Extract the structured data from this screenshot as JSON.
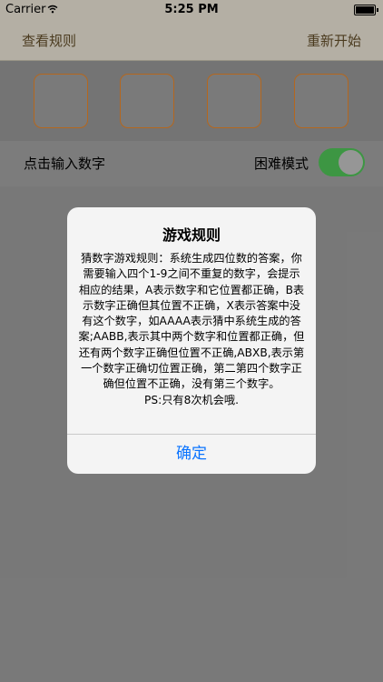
{
  "status": {
    "carrier": "Carrier",
    "time": "5:25 PM"
  },
  "nav": {
    "left_button": "查看规则",
    "right_button": "重新开始"
  },
  "controls": {
    "hint": "点击输入数字",
    "mode_label": "困难模式",
    "mode_enabled": true
  },
  "alert": {
    "title": "游戏规则",
    "message": "猜数字游戏规则：系统生成四位数的答案，你需要输入四个1-9之间不重复的数字，会提示相应的结果，A表示数字和它位置都正确，B表示数字正确但其位置不正确，X表示答案中没有这个数字，如AAAA表示猜中系统生成的答案;AABB,表示其中两个数字和位置都正确，但还有两个数字正确但位置不正确,ABXB,表示第一个数字正确切位置正确，第二第四个数字正确但位置不正确，没有第三个数字。\nPS:只有8次机会哦.",
    "confirm": "确定"
  },
  "colors": {
    "accent": "#b86a1f",
    "toggle_on": "#3f9a45",
    "link": "#0a74ff"
  },
  "icons": [
    "wifi-icon",
    "battery-icon"
  ]
}
